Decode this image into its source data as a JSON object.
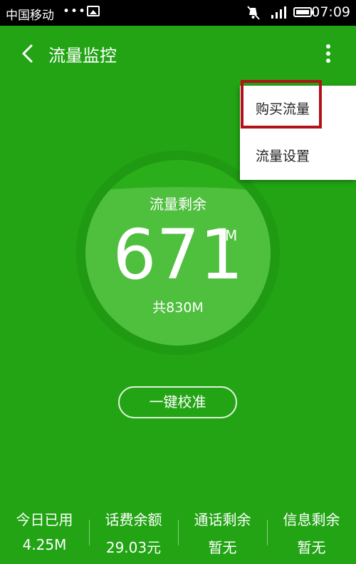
{
  "status_bar": {
    "carrier": "中国移动",
    "dots": "•••",
    "time": "07:09"
  },
  "header": {
    "title": "流量监控"
  },
  "menu": {
    "items": [
      {
        "label": "购买流量"
      },
      {
        "label": "流量设置"
      }
    ]
  },
  "gauge": {
    "label": "流量剩余",
    "remaining": "671",
    "unit": "M",
    "total": "共830M",
    "fill_fraction": 0.808
  },
  "calibrate_label": "一键校准",
  "stats": [
    {
      "label": "今日已用",
      "value": "4.25M"
    },
    {
      "label": "话费余额",
      "value": "29.03元"
    },
    {
      "label": "通话剩余",
      "value": "暂无"
    },
    {
      "label": "信息剩余",
      "value": "暂无"
    }
  ],
  "colors": {
    "background": "#22a414",
    "highlight": "#b4121b"
  },
  "icons": {
    "status": [
      "image-icon",
      "mute-icon",
      "signal-icon",
      "battery-icon"
    ],
    "header": [
      "back-icon",
      "more-icon"
    ]
  }
}
